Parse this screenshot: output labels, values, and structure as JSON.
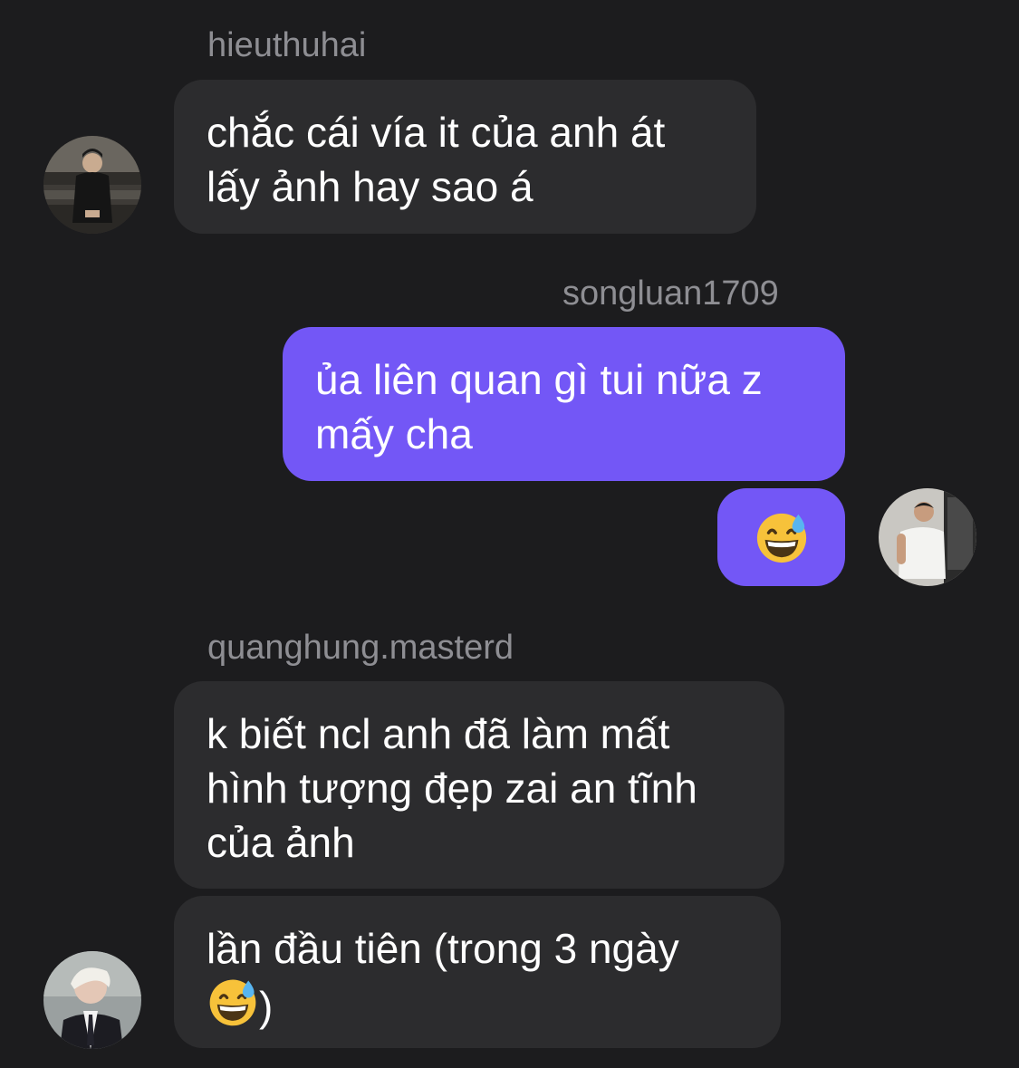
{
  "messages": [
    {
      "sender": "hieuthuhai",
      "bubbles": [
        {
          "lines": [
            "chắc cái vía it của anh át",
            "lấy ảnh hay sao á"
          ]
        }
      ]
    },
    {
      "sender": "songluan1709",
      "bubbles": [
        {
          "lines": [
            "ủa liên quan gì tui nữa z",
            "mấy cha"
          ]
        },
        {
          "emoji": "grinning-face-with-sweat"
        }
      ]
    },
    {
      "sender": "quanghung.masterd",
      "bubbles": [
        {
          "lines": [
            "k biết ncl anh đã làm mất",
            "hình tượng đẹp zai an tĩnh",
            "của ảnh"
          ]
        },
        {
          "lines": [
            "lần đầu tiên (trong 3 ngày",
            ")"
          ],
          "emoji": "grinning-face-with-sweat"
        }
      ]
    }
  ],
  "colors": {
    "background": "#1c1c1e",
    "incoming_bubble": "#2c2c2e",
    "outgoing_bubble": "#7357f6",
    "sender_text": "#8e8e93"
  }
}
